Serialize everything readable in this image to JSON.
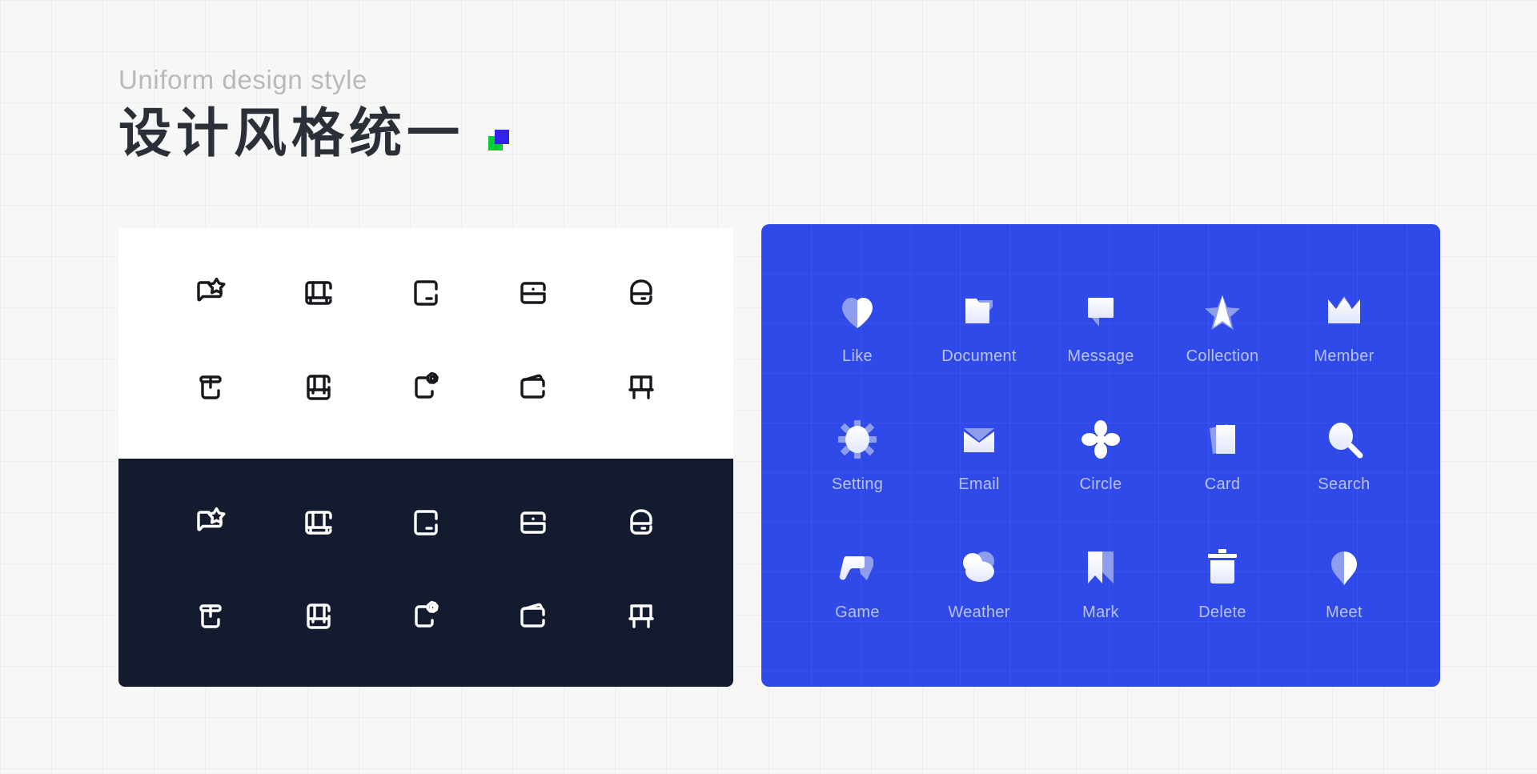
{
  "header": {
    "eyebrow": "Uniform design style",
    "title": "设计风格统一",
    "logo": {
      "green": "#00cc33",
      "blue": "#3322ee"
    }
  },
  "colors": {
    "page_background": "#f7f7f8",
    "light_panel": "#ffffff",
    "dark_panel": "#151b2e",
    "blue_panel": "#2f4ae8",
    "outline_dark_stroke": "#16181d",
    "outline_light_stroke": "#ffffff",
    "solid_icon_primary": "#ffffff",
    "solid_icon_secondary": "#9aa8ee",
    "solid_label": "#b9c2f0",
    "eyebrow_text": "#b7b9bd",
    "title_text": "#2b2f38"
  },
  "outline_panel": {
    "icons": [
      {
        "name": "chat-star-icon",
        "label": "chat-star"
      },
      {
        "name": "sofa-icon",
        "label": "sofa"
      },
      {
        "name": "rounded-square-dash-icon",
        "label": "rounded-square-dash"
      },
      {
        "name": "card-split-icon",
        "label": "card-split"
      },
      {
        "name": "capsule-split-icon",
        "label": "capsule-split"
      },
      {
        "name": "box-open-icon",
        "label": "box-open"
      },
      {
        "name": "drawer-icon",
        "label": "drawer"
      },
      {
        "name": "square-gear-icon",
        "label": "square-gear"
      },
      {
        "name": "wallet-icon",
        "label": "wallet"
      },
      {
        "name": "table-icon",
        "label": "table"
      }
    ]
  },
  "solid_panel": {
    "icons": [
      {
        "name": "heart-icon",
        "label": "Like"
      },
      {
        "name": "folder-icon",
        "label": "Document"
      },
      {
        "name": "message-bubble-icon",
        "label": "Message"
      },
      {
        "name": "star-icon",
        "label": "Collection"
      },
      {
        "name": "crown-icon",
        "label": "Member"
      },
      {
        "name": "gear-icon",
        "label": "Setting"
      },
      {
        "name": "envelope-icon",
        "label": "Email"
      },
      {
        "name": "clover-icon",
        "label": "Circle"
      },
      {
        "name": "card-stack-icon",
        "label": "Card"
      },
      {
        "name": "search-icon",
        "label": "Search"
      },
      {
        "name": "gamepad-icon",
        "label": "Game"
      },
      {
        "name": "cloud-icon",
        "label": "Weather"
      },
      {
        "name": "bookmark-icon",
        "label": "Mark"
      },
      {
        "name": "trash-icon",
        "label": "Delete"
      },
      {
        "name": "location-pin-icon",
        "label": "Meet"
      }
    ]
  }
}
